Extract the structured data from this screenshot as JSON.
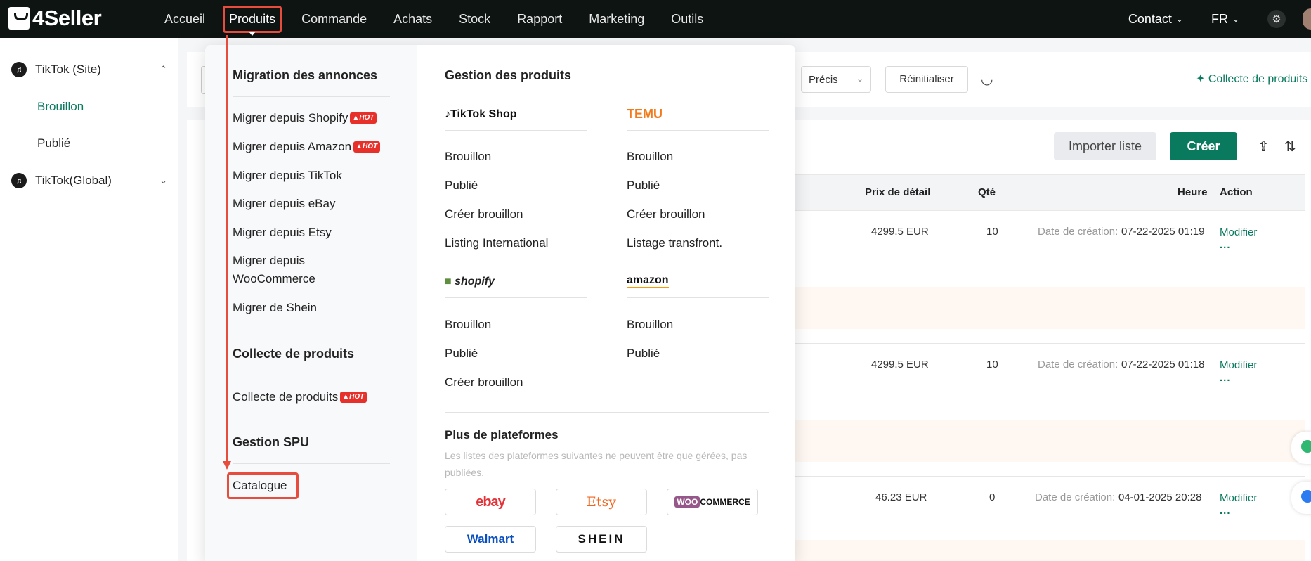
{
  "brand": {
    "name": "4Seller"
  },
  "nav": {
    "items": [
      "Accueil",
      "Produits",
      "Commande",
      "Achats",
      "Stock",
      "Rapport",
      "Marketing",
      "Outils"
    ],
    "active": "Produits"
  },
  "top_right": {
    "contact": "Contact",
    "language": "FR"
  },
  "sidebar": {
    "group1": "TikTok (Site)",
    "group1_items": [
      "Brouillon",
      "Publié"
    ],
    "group2": "TikTok(Global)"
  },
  "filters": {
    "match_mode": "Précis",
    "reset_label": "Réinitialiser",
    "collect_link": "Collecte de produits"
  },
  "actions": {
    "import_label": "Importer liste",
    "create_label": "Créer"
  },
  "table": {
    "headers": {
      "price": "Prix de détail",
      "qty": "Qté",
      "time": "Heure",
      "action": "Action"
    },
    "rows": [
      {
        "price": "4299.5 EUR",
        "qty": "10",
        "time_label": "Date de création:",
        "time_value": "07-22-2025 01:19",
        "action": "Modifier",
        "more": "..."
      },
      {
        "price": "4299.5 EUR",
        "qty": "10",
        "time_label": "Date de création:",
        "time_value": "07-22-2025 01:18",
        "action": "Modifier",
        "more": "..."
      },
      {
        "price": "46.23 EUR",
        "qty": "0",
        "time_label": "Date de création:",
        "time_value": "04-01-2025 20:28",
        "action": "Modifier",
        "more": "..."
      }
    ]
  },
  "menu": {
    "migration": {
      "title": "Migration des annonces",
      "items": [
        {
          "label": "Migrer depuis Shopify",
          "hot": "HOT"
        },
        {
          "label": "Migrer depuis Amazon",
          "hot": "HOT"
        },
        {
          "label": "Migrer depuis TikTok",
          "hot": ""
        },
        {
          "label": "Migrer depuis eBay",
          "hot": ""
        },
        {
          "label": "Migrer depuis Etsy",
          "hot": ""
        },
        {
          "label": "Migrer depuis",
          "label_line2": "WooCommerce",
          "hot": ""
        },
        {
          "label": "Migrer de Shein",
          "hot": ""
        }
      ]
    },
    "collecte": {
      "title": "Collecte de produits",
      "item": "Collecte de produits",
      "hot": "HOT"
    },
    "spu": {
      "title": "Gestion SPU",
      "item": "Catalogue"
    },
    "gestion": {
      "title": "Gestion des produits",
      "tiktok": {
        "logo": "TikTok Shop",
        "items": [
          "Brouillon",
          "Publié",
          "Créer brouillon",
          "Listing International"
        ]
      },
      "temu": {
        "logo": "TEMU",
        "items": [
          "Brouillon",
          "Publié",
          "Créer brouillon",
          "Listage transfront."
        ]
      },
      "shopify": {
        "logo": "shopify",
        "items": [
          "Brouillon",
          "Publié",
          "Créer brouillon"
        ]
      },
      "amazon": {
        "logo": "amazon",
        "items": [
          "Brouillon",
          "Publié"
        ]
      }
    },
    "plus": {
      "title": "Plus de plateformes",
      "desc": "Les listes des plateformes suivantes ne peuvent être que gérées, pas publiées.",
      "platforms": [
        "ebay",
        "Etsy",
        "COMMERCE",
        "Walmart",
        "SHEIN"
      ],
      "woo_prefix": "WOO"
    }
  },
  "colors": {
    "accent": "#0a7a5e",
    "topbar": "#0d1412",
    "annotation": "#e74c3c",
    "hot": "#e8302a"
  }
}
